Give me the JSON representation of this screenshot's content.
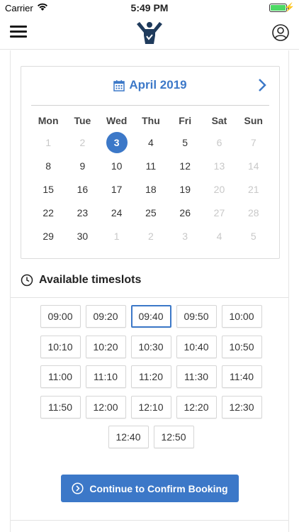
{
  "status_bar": {
    "carrier": "Carrier",
    "time": "5:49 PM"
  },
  "calendar": {
    "month_label": "April 2019",
    "weekdays": [
      "Mon",
      "Tue",
      "Wed",
      "Thu",
      "Fri",
      "Sat",
      "Sun"
    ],
    "weeks": [
      [
        {
          "d": "1",
          "s": "disabled"
        },
        {
          "d": "2",
          "s": "disabled"
        },
        {
          "d": "3",
          "s": "selected"
        },
        {
          "d": "4",
          "s": "normal"
        },
        {
          "d": "5",
          "s": "normal"
        },
        {
          "d": "6",
          "s": "disabled"
        },
        {
          "d": "7",
          "s": "disabled"
        }
      ],
      [
        {
          "d": "8",
          "s": "normal"
        },
        {
          "d": "9",
          "s": "normal"
        },
        {
          "d": "10",
          "s": "normal"
        },
        {
          "d": "11",
          "s": "normal"
        },
        {
          "d": "12",
          "s": "normal"
        },
        {
          "d": "13",
          "s": "disabled"
        },
        {
          "d": "14",
          "s": "disabled"
        }
      ],
      [
        {
          "d": "15",
          "s": "normal"
        },
        {
          "d": "16",
          "s": "normal"
        },
        {
          "d": "17",
          "s": "normal"
        },
        {
          "d": "18",
          "s": "normal"
        },
        {
          "d": "19",
          "s": "normal"
        },
        {
          "d": "20",
          "s": "disabled"
        },
        {
          "d": "21",
          "s": "disabled"
        }
      ],
      [
        {
          "d": "22",
          "s": "normal"
        },
        {
          "d": "23",
          "s": "normal"
        },
        {
          "d": "24",
          "s": "normal"
        },
        {
          "d": "25",
          "s": "normal"
        },
        {
          "d": "26",
          "s": "normal"
        },
        {
          "d": "27",
          "s": "disabled"
        },
        {
          "d": "28",
          "s": "disabled"
        }
      ],
      [
        {
          "d": "29",
          "s": "normal"
        },
        {
          "d": "30",
          "s": "normal"
        },
        {
          "d": "1",
          "s": "disabled"
        },
        {
          "d": "2",
          "s": "disabled"
        },
        {
          "d": "3",
          "s": "disabled"
        },
        {
          "d": "4",
          "s": "disabled"
        },
        {
          "d": "5",
          "s": "disabled"
        }
      ]
    ]
  },
  "timeslots": {
    "title": "Available timeslots",
    "selected": "09:40",
    "slots": [
      "09:00",
      "09:20",
      "09:40",
      "09:50",
      "10:00",
      "10:10",
      "10:20",
      "10:30",
      "10:40",
      "10:50",
      "11:00",
      "11:10",
      "11:20",
      "11:30",
      "11:40",
      "11:50",
      "12:00",
      "12:10",
      "12:20",
      "12:30",
      "12:40",
      "12:50"
    ]
  },
  "cta": {
    "label": "Continue to Confirm Booking"
  },
  "colors": {
    "accent": "#3c78c8",
    "battery": "#4cd964"
  }
}
